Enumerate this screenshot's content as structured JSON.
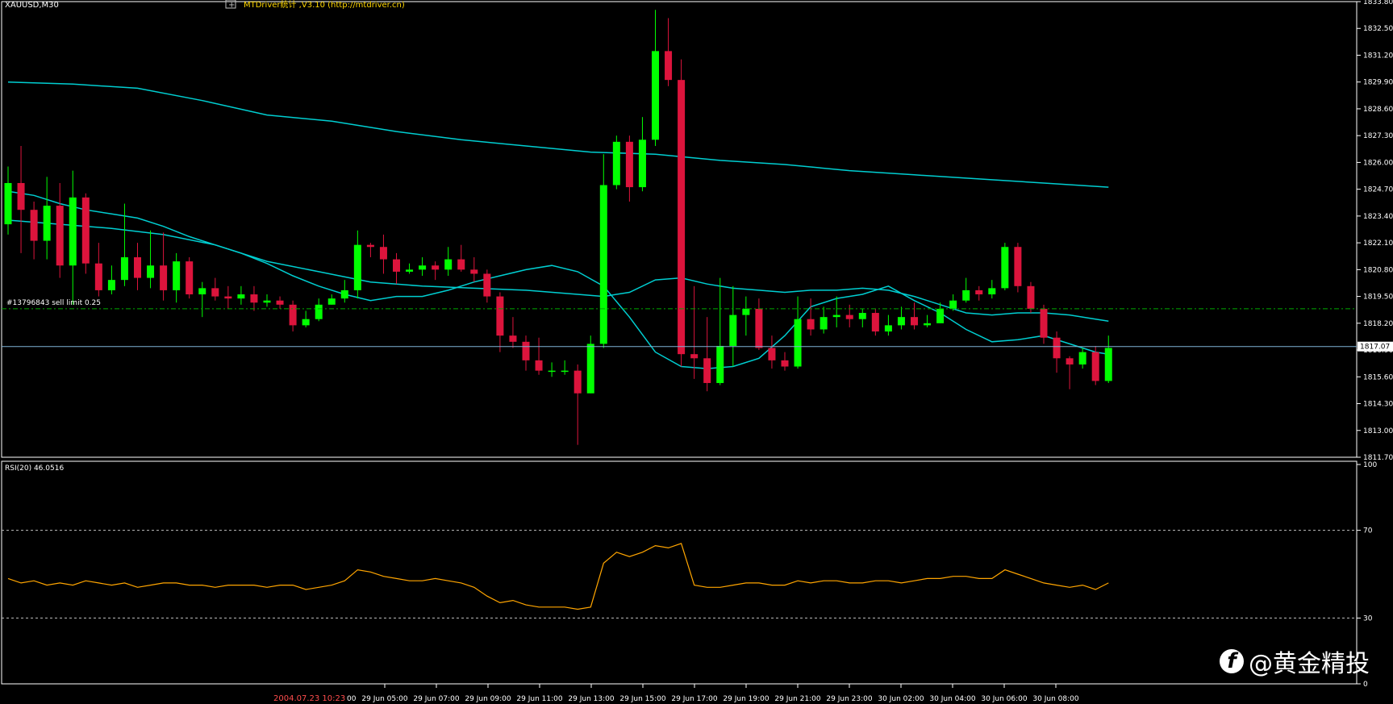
{
  "window": {
    "symbol_label": "XAUUSD,M30",
    "plugin_label": "MTDriver统计 ,V3.10 (http://mtdriver.cn)",
    "order_label": "#13796843 sell limit 0.25",
    "current_price_label": "1817.07",
    "rsi_label": "RSI(20) 46.0516",
    "date_marker": "2004.07.23 10:23",
    "watermark": "@黄金精投"
  },
  "colors": {
    "background": "#000000",
    "bull_candle": "#00ff00",
    "bear_candle": "#dc143c",
    "ma_line": "#00ced1",
    "grid_text": "#ffffff",
    "order_line": "#00aa00",
    "price_line": "#7fb2d6",
    "rsi_line": "#ffa500",
    "date_marker_color": "#ff4d4d",
    "plugin_text": "#ffd700"
  },
  "chart_data": [
    {
      "type": "candlestick",
      "title": "XAUUSD,M30",
      "ylim": [
        1811.7,
        1833.8
      ],
      "y_ticks": [
        "1833.80",
        "1832.50",
        "1831.20",
        "1829.90",
        "1828.60",
        "1827.30",
        "1826.00",
        "1824.70",
        "1823.40",
        "1822.10",
        "1820.80",
        "1819.50",
        "1818.20",
        "1816.90",
        "1815.60",
        "1814.30",
        "1813.00",
        "1811.70"
      ],
      "x_ticks": [
        "29 Jun 05:00",
        "29 Jun 07:00",
        "29 Jun 09:00",
        "29 Jun 11:00",
        "29 Jun 13:00",
        "29 Jun 15:00",
        "29 Jun 17:00",
        "29 Jun 19:00",
        "29 Jun 21:00",
        "29 Jun 23:00",
        "30 Jun 02:00",
        "30 Jun 04:00",
        "30 Jun 06:00",
        "30 Jun 08:00"
      ],
      "grid": false,
      "order_level": 1818.9,
      "current_price": 1817.07,
      "candles": [
        [
          1823.0,
          1825.0,
          1822.5,
          1825.8
        ],
        [
          1825.0,
          1823.7,
          1821.6,
          1826.8
        ],
        [
          1823.7,
          1822.2,
          1821.3,
          1824.1
        ],
        [
          1822.2,
          1823.9,
          1821.3,
          1825.3
        ],
        [
          1823.9,
          1821.0,
          1820.4,
          1825.0
        ],
        [
          1821.0,
          1824.3,
          1819.1,
          1825.6
        ],
        [
          1824.3,
          1821.1,
          1820.6,
          1824.5
        ],
        [
          1821.1,
          1819.8,
          1819.5,
          1822.1
        ],
        [
          1819.8,
          1820.3,
          1819.6,
          1821.0
        ],
        [
          1820.3,
          1821.4,
          1820.0,
          1824.0
        ],
        [
          1821.4,
          1820.4,
          1819.8,
          1822.1
        ],
        [
          1820.4,
          1821.0,
          1819.9,
          1822.7
        ],
        [
          1821.0,
          1819.8,
          1819.3,
          1822.6
        ],
        [
          1819.8,
          1821.2,
          1819.2,
          1821.6
        ],
        [
          1821.2,
          1819.6,
          1819.4,
          1821.4
        ],
        [
          1819.6,
          1819.9,
          1818.5,
          1820.2
        ],
        [
          1819.9,
          1819.5,
          1819.3,
          1820.4
        ],
        [
          1819.5,
          1819.4,
          1818.9,
          1820.0
        ],
        [
          1819.4,
          1819.6,
          1819.1,
          1820.0
        ],
        [
          1819.6,
          1819.2,
          1818.8,
          1820.0
        ],
        [
          1819.2,
          1819.3,
          1819.0,
          1819.6
        ],
        [
          1819.3,
          1819.1,
          1818.9,
          1819.5
        ],
        [
          1819.1,
          1818.1,
          1817.8,
          1819.3
        ],
        [
          1818.1,
          1818.4,
          1818.0,
          1818.8
        ],
        [
          1818.4,
          1819.1,
          1818.3,
          1819.4
        ],
        [
          1819.1,
          1819.4,
          1819.1,
          1819.6
        ],
        [
          1819.4,
          1819.8,
          1819.2,
          1820.3
        ],
        [
          1819.8,
          1822.0,
          1819.4,
          1822.7
        ],
        [
          1822.0,
          1821.9,
          1821.4,
          1822.1
        ],
        [
          1821.9,
          1821.3,
          1820.6,
          1822.5
        ],
        [
          1821.3,
          1820.7,
          1820.1,
          1821.6
        ],
        [
          1820.7,
          1820.8,
          1820.6,
          1821.1
        ],
        [
          1820.8,
          1821.0,
          1820.5,
          1821.4
        ],
        [
          1821.0,
          1820.8,
          1820.3,
          1821.2
        ],
        [
          1820.8,
          1821.3,
          1820.5,
          1821.9
        ],
        [
          1821.3,
          1820.8,
          1820.7,
          1822.0
        ],
        [
          1820.8,
          1820.6,
          1820.2,
          1821.4
        ],
        [
          1820.6,
          1819.5,
          1819.2,
          1820.8
        ],
        [
          1819.5,
          1817.6,
          1816.8,
          1819.7
        ],
        [
          1817.6,
          1817.3,
          1817.0,
          1818.5
        ],
        [
          1817.3,
          1816.4,
          1815.9,
          1817.6
        ],
        [
          1816.4,
          1815.9,
          1815.7,
          1817.5
        ],
        [
          1815.9,
          1815.9,
          1815.6,
          1816.3
        ],
        [
          1815.9,
          1815.9,
          1815.7,
          1816.4
        ],
        [
          1815.9,
          1814.8,
          1812.3,
          1816.2
        ],
        [
          1814.8,
          1817.2,
          1814.8,
          1817.6
        ],
        [
          1817.2,
          1824.9,
          1817.0,
          1826.4
        ],
        [
          1824.9,
          1827.0,
          1824.7,
          1827.3
        ],
        [
          1827.0,
          1824.8,
          1824.1,
          1827.3
        ],
        [
          1824.8,
          1827.1,
          1824.6,
          1828.2
        ],
        [
          1827.1,
          1831.4,
          1826.8,
          1833.4
        ],
        [
          1831.4,
          1830.0,
          1829.7,
          1833.0
        ],
        [
          1830.0,
          1816.7,
          1816.1,
          1831.0
        ],
        [
          1816.7,
          1816.5,
          1815.5,
          1820.0
        ],
        [
          1816.5,
          1815.3,
          1814.9,
          1818.5
        ],
        [
          1815.3,
          1817.1,
          1815.2,
          1820.4
        ],
        [
          1817.1,
          1818.6,
          1816.1,
          1820.0
        ],
        [
          1818.6,
          1818.9,
          1817.6,
          1819.5
        ],
        [
          1818.9,
          1817.0,
          1816.9,
          1819.4
        ],
        [
          1817.0,
          1816.4,
          1816.0,
          1817.6
        ],
        [
          1816.4,
          1816.1,
          1815.9,
          1816.8
        ],
        [
          1816.1,
          1818.4,
          1816.0,
          1819.5
        ],
        [
          1818.4,
          1817.9,
          1817.6,
          1819.4
        ],
        [
          1817.9,
          1818.5,
          1817.7,
          1819.0
        ],
        [
          1818.5,
          1818.6,
          1818.0,
          1819.5
        ],
        [
          1818.6,
          1818.4,
          1818.0,
          1819.1
        ],
        [
          1818.4,
          1818.7,
          1818.0,
          1818.9
        ],
        [
          1818.7,
          1817.8,
          1817.6,
          1818.9
        ],
        [
          1817.8,
          1818.1,
          1817.6,
          1818.6
        ],
        [
          1818.1,
          1818.5,
          1817.9,
          1819.0
        ],
        [
          1818.5,
          1818.1,
          1817.9,
          1819.2
        ],
        [
          1818.1,
          1818.2,
          1818.0,
          1818.6
        ],
        [
          1818.2,
          1818.9,
          1818.2,
          1819.2
        ],
        [
          1818.9,
          1819.3,
          1818.8,
          1819.6
        ],
        [
          1819.3,
          1819.8,
          1819.2,
          1820.4
        ],
        [
          1819.8,
          1819.6,
          1819.3,
          1820.0
        ],
        [
          1819.6,
          1819.9,
          1819.4,
          1820.3
        ],
        [
          1819.9,
          1821.9,
          1819.8,
          1822.1
        ],
        [
          1821.9,
          1820.0,
          1819.7,
          1822.1
        ],
        [
          1820.0,
          1818.9,
          1818.7,
          1820.2
        ],
        [
          1818.9,
          1817.5,
          1817.2,
          1819.1
        ],
        [
          1817.5,
          1816.5,
          1815.8,
          1817.8
        ],
        [
          1816.5,
          1816.2,
          1815.0,
          1816.6
        ],
        [
          1816.2,
          1816.8,
          1816.0,
          1817.0
        ],
        [
          1816.8,
          1815.4,
          1815.2,
          1817.1
        ],
        [
          1815.4,
          1817.0,
          1815.3,
          1817.6
        ]
      ],
      "moving_averages": [
        {
          "points": [
            [
              0,
              1824.6
            ],
            [
              2,
              1824.4
            ],
            [
              4,
              1824.0
            ],
            [
              6,
              1823.7
            ],
            [
              8,
              1823.5
            ],
            [
              10,
              1823.3
            ],
            [
              12,
              1822.9
            ],
            [
              14,
              1822.4
            ],
            [
              16,
              1822.0
            ],
            [
              18,
              1821.6
            ],
            [
              20,
              1821.1
            ],
            [
              22,
              1820.5
            ],
            [
              24,
              1820.0
            ],
            [
              26,
              1819.6
            ],
            [
              28,
              1819.3
            ],
            [
              30,
              1819.5
            ],
            [
              32,
              1819.5
            ],
            [
              34,
              1819.8
            ],
            [
              36,
              1820.2
            ],
            [
              38,
              1820.5
            ],
            [
              40,
              1820.8
            ],
            [
              42,
              1821.0
            ],
            [
              44,
              1820.7
            ],
            [
              46,
              1820.0
            ],
            [
              48,
              1818.5
            ],
            [
              50,
              1816.8
            ],
            [
              52,
              1816.1
            ],
            [
              54,
              1816.0
            ],
            [
              56,
              1816.1
            ],
            [
              58,
              1816.5
            ],
            [
              60,
              1817.6
            ],
            [
              62,
              1819.0
            ],
            [
              64,
              1819.4
            ],
            [
              66,
              1819.6
            ],
            [
              68,
              1820.0
            ],
            [
              70,
              1819.3
            ],
            [
              72,
              1818.7
            ],
            [
              74,
              1817.9
            ],
            [
              76,
              1817.3
            ],
            [
              78,
              1817.4
            ],
            [
              80,
              1817.6
            ],
            [
              82,
              1817.2
            ],
            [
              84,
              1816.8
            ],
            [
              85,
              1816.7
            ]
          ]
        },
        {
          "points": [
            [
              0,
              1823.2
            ],
            [
              4,
              1823.0
            ],
            [
              8,
              1822.8
            ],
            [
              12,
              1822.5
            ],
            [
              16,
              1822.0
            ],
            [
              20,
              1821.2
            ],
            [
              24,
              1820.7
            ],
            [
              28,
              1820.2
            ],
            [
              32,
              1820.0
            ],
            [
              36,
              1819.9
            ],
            [
              40,
              1819.8
            ],
            [
              44,
              1819.6
            ],
            [
              46,
              1819.5
            ],
            [
              48,
              1819.7
            ],
            [
              50,
              1820.3
            ],
            [
              52,
              1820.4
            ],
            [
              54,
              1820.1
            ],
            [
              56,
              1819.9
            ],
            [
              58,
              1819.8
            ],
            [
              60,
              1819.7
            ],
            [
              62,
              1819.8
            ],
            [
              64,
              1819.8
            ],
            [
              66,
              1819.9
            ],
            [
              68,
              1819.8
            ],
            [
              70,
              1819.5
            ],
            [
              72,
              1819.1
            ],
            [
              74,
              1818.7
            ],
            [
              76,
              1818.6
            ],
            [
              78,
              1818.7
            ],
            [
              80,
              1818.7
            ],
            [
              82,
              1818.6
            ],
            [
              84,
              1818.4
            ],
            [
              85,
              1818.3
            ]
          ]
        },
        {
          "points": [
            [
              0,
              1829.9
            ],
            [
              5,
              1829.8
            ],
            [
              10,
              1829.6
            ],
            [
              15,
              1829.0
            ],
            [
              20,
              1828.3
            ],
            [
              25,
              1828.0
            ],
            [
              30,
              1827.5
            ],
            [
              35,
              1827.1
            ],
            [
              40,
              1826.8
            ],
            [
              45,
              1826.5
            ],
            [
              50,
              1826.4
            ],
            [
              55,
              1826.1
            ],
            [
              60,
              1825.9
            ],
            [
              65,
              1825.6
            ],
            [
              70,
              1825.4
            ],
            [
              75,
              1825.2
            ],
            [
              80,
              1825.0
            ],
            [
              85,
              1824.8
            ]
          ]
        }
      ]
    },
    {
      "type": "line",
      "title": "RSI(20) 46.0516",
      "ylim": [
        0,
        100
      ],
      "y_ticks": [
        "100",
        "70",
        "30",
        "0"
      ],
      "levels": [
        70,
        30
      ],
      "values": [
        48,
        46,
        47,
        45,
        46,
        45,
        47,
        46,
        45,
        46,
        44,
        45,
        46,
        46,
        45,
        45,
        44,
        45,
        45,
        45,
        44,
        45,
        45,
        43,
        44,
        45,
        47,
        52,
        51,
        49,
        48,
        47,
        47,
        48,
        47,
        46,
        44,
        40,
        37,
        38,
        36,
        35,
        35,
        35,
        34,
        35,
        55,
        60,
        58,
        60,
        63,
        62,
        64,
        45,
        44,
        44,
        45,
        46,
        46,
        45,
        45,
        47,
        46,
        47,
        47,
        46,
        46,
        47,
        47,
        46,
        47,
        48,
        48,
        49,
        49,
        48,
        48,
        52,
        50,
        48,
        46,
        45,
        44,
        45,
        43,
        46
      ]
    }
  ]
}
